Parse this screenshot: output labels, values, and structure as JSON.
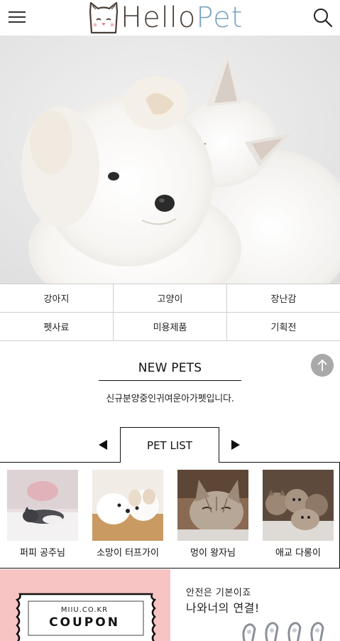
{
  "header": {
    "logo_hello": "Hello",
    "logo_pet": "Pet",
    "menu_icon": "hamburger-menu-icon",
    "search_icon": "search-icon"
  },
  "hero": {
    "image_label": "hero-photo-puppy-and-kitten"
  },
  "categories": [
    {
      "label": "강아지"
    },
    {
      "label": "고양이"
    },
    {
      "label": "장난감"
    },
    {
      "label": "펫사료"
    },
    {
      "label": "미용제품"
    },
    {
      "label": "기획전"
    }
  ],
  "new_pets": {
    "title": "NEW PETS",
    "subtitle": "신규분양중인귀여운아가펫입니다."
  },
  "pet_list": {
    "tab_label": "PET LIST",
    "prev_icon": "arrow-left-icon",
    "next_icon": "arrow-right-icon",
    "items": [
      {
        "name": "퍼피 공주님"
      },
      {
        "name": "소망이 터프가이"
      },
      {
        "name": "멍이 왕자님"
      },
      {
        "name": "애교 다롱이"
      }
    ]
  },
  "banners": {
    "coupon_site": "MIIU.CO.KR",
    "coupon_word": "COUPON",
    "right_line1": "안전은 기본이죠",
    "right_line2": "나와너의 연결!"
  },
  "colors": {
    "logo_dark": "#4a3f38",
    "logo_blue": "#7aa4c0",
    "coupon_bg": "#f8c3c3",
    "top_button": "#a9a9a9"
  }
}
